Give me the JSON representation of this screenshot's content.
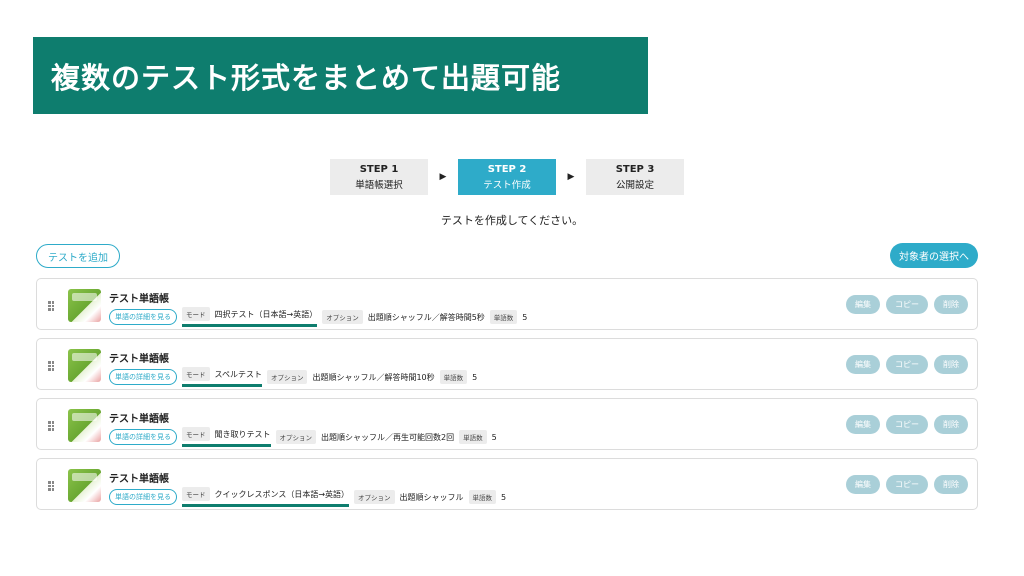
{
  "banner": {
    "title": "複数のテスト形式をまとめて出題可能"
  },
  "steps": [
    {
      "num": "STEP 1",
      "label": "単語帳選択"
    },
    {
      "num": "STEP 2",
      "label": "テスト作成"
    },
    {
      "num": "STEP 3",
      "label": "公開設定"
    }
  ],
  "arrow_glyph": "▶",
  "instruction": "テストを作成してください。",
  "buttons": {
    "add_test": "テストを追加",
    "next": "対象者の選択へ"
  },
  "common": {
    "card_title": "テスト単語帳",
    "details_link": "単語の詳細を見る",
    "mode_tag": "モード",
    "option_tag": "オプション",
    "count_tag": "単語数",
    "edit": "編集",
    "copy": "コピー",
    "delete": "削除"
  },
  "tests": [
    {
      "mode": "四択テスト（日本語→英語）",
      "options": "出題順シャッフル／解答時間5秒",
      "count": "5"
    },
    {
      "mode": "スペルテスト",
      "options": "出題順シャッフル／解答時間10秒",
      "count": "5"
    },
    {
      "mode": "聞き取りテスト",
      "options": "出題順シャッフル／再生可能回数2回",
      "count": "5"
    },
    {
      "mode": "クイックレスポンス（日本語→英語）",
      "options": "出題順シャッフル",
      "count": "5"
    }
  ],
  "colors": {
    "brand_green": "#0e7d6e",
    "accent_blue": "#2eabc9",
    "muted_button": "#a9cfd8"
  }
}
